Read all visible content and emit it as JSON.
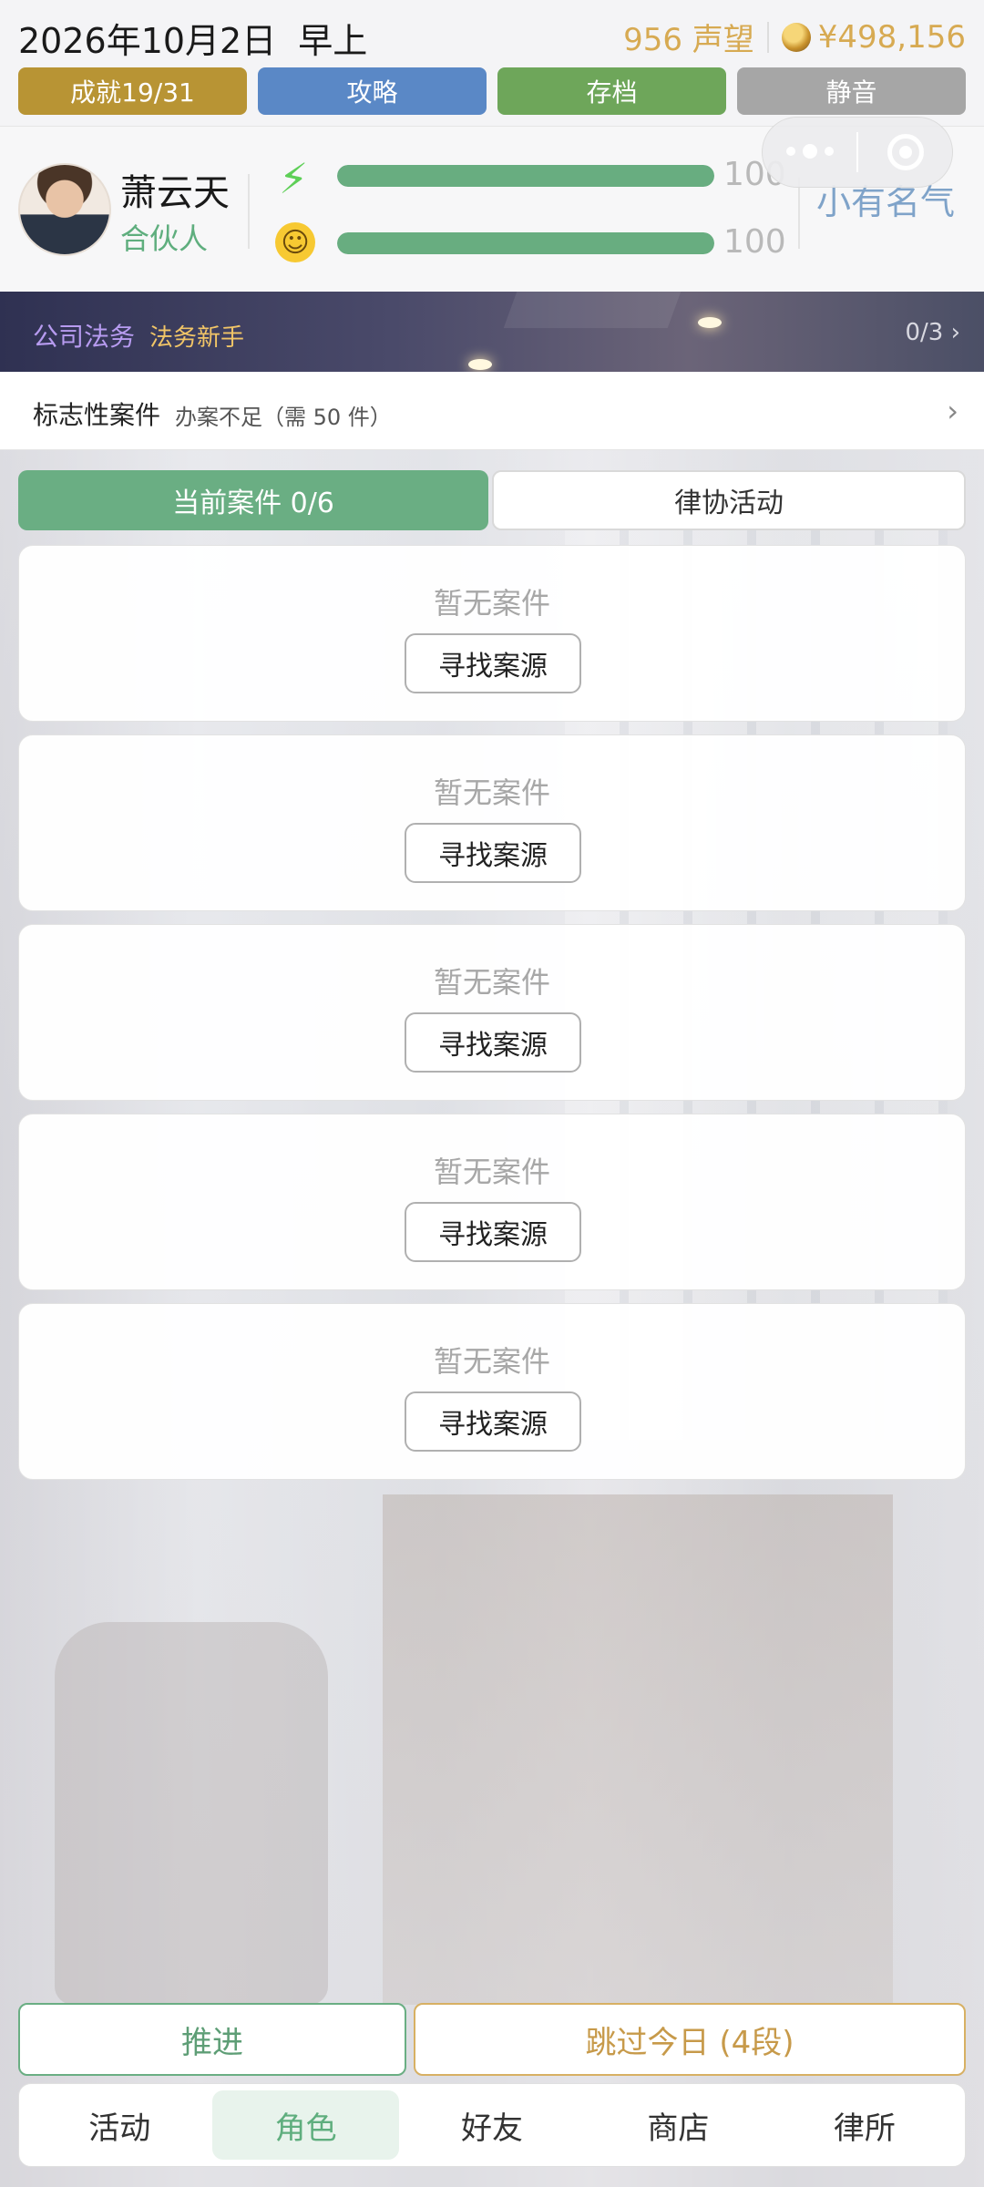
{
  "status": {
    "date": "2026年10月2日",
    "period": "早上",
    "reputation": "956 声望",
    "money": "¥498,156"
  },
  "top_buttons": {
    "achievements": "成就19/31",
    "guide": "攻略",
    "save": "存档",
    "mute": "静音"
  },
  "profile": {
    "name": "萧云天",
    "title": "合伙人",
    "energy_value": "100",
    "energy_level": 1.0,
    "mood_value": "100",
    "mood_level": 1.0,
    "fame_label": "小有名气"
  },
  "banner": {
    "category": "公司法务",
    "rank": "法务新手",
    "progress": "0/3"
  },
  "landmark": {
    "title": "标志性案件",
    "subtitle": "办案不足（需 50 件）"
  },
  "tabs": {
    "current": "当前案件 0/6",
    "activities": "律协活动"
  },
  "cards": [
    {
      "empty": "暂无案件",
      "button": "寻找案源"
    },
    {
      "empty": "暂无案件",
      "button": "寻找案源"
    },
    {
      "empty": "暂无案件",
      "button": "寻找案源"
    },
    {
      "empty": "暂无案件",
      "button": "寻找案源"
    },
    {
      "empty": "暂无案件",
      "button": "寻找案源"
    }
  ],
  "actions": {
    "advance": "推进",
    "skip": "跳过今日 (4段)"
  },
  "nav": [
    "活动",
    "角色",
    "好友",
    "商店",
    "律所"
  ],
  "colors": {
    "accent_green": "#6aae83",
    "gold": "#d7aa52",
    "achievements": "#b89434",
    "guide": "#5a88c6",
    "save": "#6ea65a",
    "mute": "#a6a6a6"
  },
  "icons": {
    "energy": "lightning-icon",
    "mood": "smiley-icon",
    "money": "money-bag-icon",
    "capsule_more": "more-dots-icon",
    "capsule_close": "target-icon"
  }
}
